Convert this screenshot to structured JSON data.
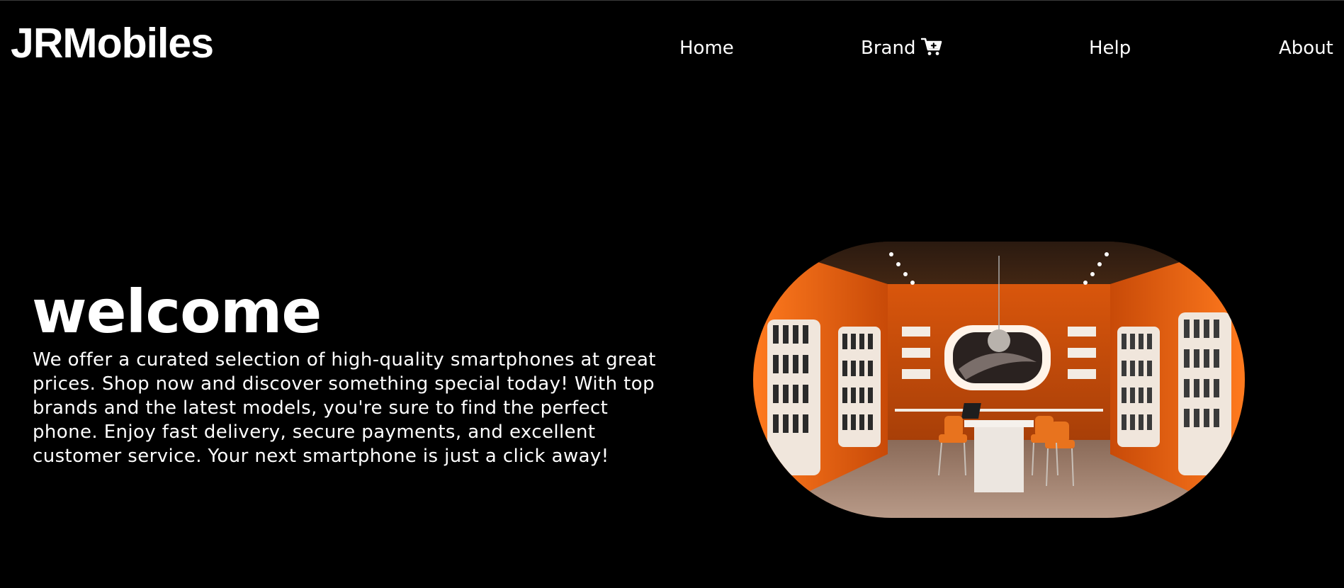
{
  "header": {
    "logo": "JRMobiles"
  },
  "nav": {
    "home": "Home",
    "brand": "Brand",
    "brand_icon": "cart-plus-icon",
    "help": "Help",
    "about": "About"
  },
  "hero": {
    "title": "welcome",
    "description": "We offer a curated selection of high-quality smartphones at great prices. Shop now and discover something special today! With top brands and the latest models, you're sure to find the perfect phone. Enjoy fast delivery, secure payments, and excellent customer service. Your next smartphone is just a click away!"
  },
  "colors": {
    "background": "#000000",
    "text": "#ffffff",
    "accent": "#ff6a13"
  }
}
